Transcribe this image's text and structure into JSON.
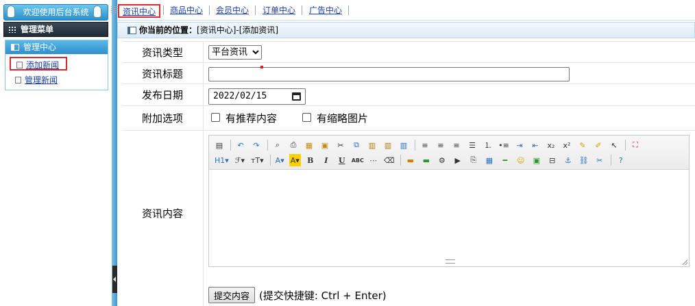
{
  "sidebar": {
    "welcome": "欢迎使用后台系统",
    "menu_title": "管理菜单",
    "panel_title": "管理中心",
    "items": [
      {
        "label": "添加新闻"
      },
      {
        "label": "管理新闻"
      }
    ]
  },
  "topnav": {
    "tabs": [
      {
        "label": "资讯中心"
      },
      {
        "label": "商品中心"
      },
      {
        "label": "会员中心"
      },
      {
        "label": "订单中心"
      },
      {
        "label": "广告中心"
      }
    ]
  },
  "breadcrumb": {
    "label": "你当前的位置：",
    "path": "[资讯中心]-[添加资讯]"
  },
  "form": {
    "type_label": "资讯类型",
    "type_value": "平台资讯",
    "title_label": "资讯标题",
    "title_value": "",
    "date_label": "发布日期",
    "date_value": "2022/02/15",
    "options_label": "附加选项",
    "option_recommend": "有推荐内容",
    "option_thumbnail": "有缩略图片",
    "content_label": "资讯内容",
    "submit_label": "提交内容",
    "submit_hint": "(提交快捷键: Ctrl + Enter)"
  },
  "editor": {
    "heading_btn": "H1",
    "font_btn": "ℱ",
    "size_btn": "тT",
    "bold": "B",
    "italic": "I",
    "underline": "U",
    "strike": "ABC"
  },
  "colors": {
    "accent_blue": "#2b8fca",
    "highlight_red": "#e0282e",
    "link": "#1a3ea8"
  }
}
